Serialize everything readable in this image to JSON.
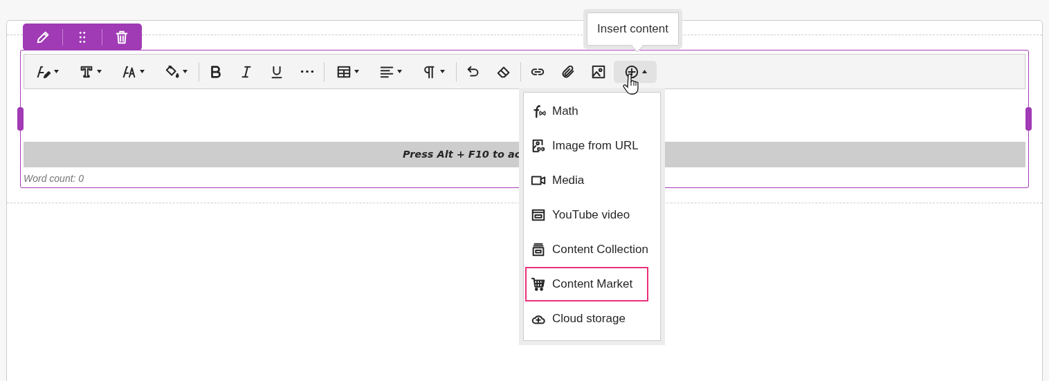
{
  "block_toolbar": [
    {
      "kind": "edit"
    },
    {
      "kind": "move"
    },
    {
      "kind": "delete"
    }
  ],
  "editor_toolbar": [
    [
      {
        "caret": true
      },
      {
        "caret": true
      },
      {
        "caret": true
      },
      {
        "caret": true
      }
    ],
    [
      {
        "caret": false
      },
      {
        "caret": false
      },
      {
        "caret": false
      },
      {
        "caret": false
      }
    ],
    [
      {
        "caret": true
      },
      {
        "caret": true
      },
      {
        "caret": true
      }
    ],
    [
      {
        "caret": false
      },
      {
        "caret": false
      }
    ],
    [
      {
        "caret": false
      },
      {
        "caret": false
      },
      {
        "caret": false
      },
      {
        "caret": true,
        "expanded": true
      }
    ]
  ],
  "accessibility_hint": "Press Alt + F10 to ac",
  "word_count": "Word count: 0",
  "tooltip": "Insert content",
  "insert_menu": [
    {
      "label": "Math",
      "highlighted": false
    },
    {
      "label": "Image from URL",
      "highlighted": false
    },
    {
      "label": "Media",
      "highlighted": false
    },
    {
      "label": "YouTube video",
      "highlighted": false
    },
    {
      "label": "Content Collection",
      "highlighted": false
    },
    {
      "label": "Content Market",
      "highlighted": true
    },
    {
      "label": "Cloud storage",
      "highlighted": false
    }
  ]
}
